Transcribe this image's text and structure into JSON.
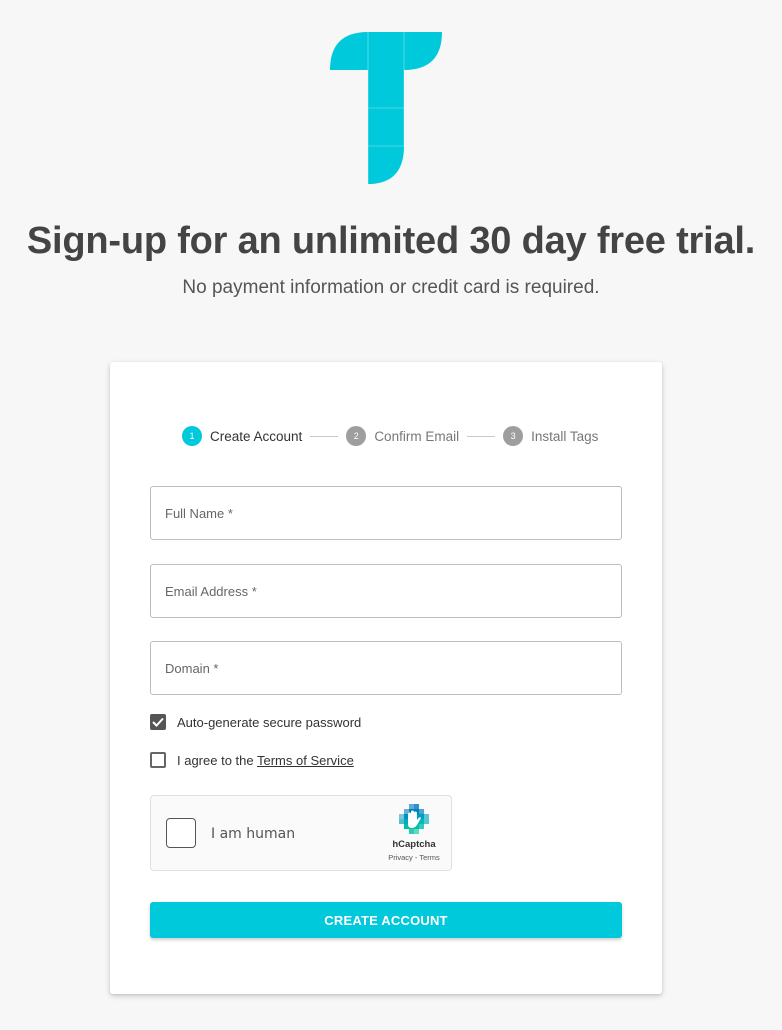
{
  "brand": {
    "accent": "#00c9db",
    "logo_icon": "t-logo-icon"
  },
  "headline": "Sign-up for an unlimited 30 day free trial.",
  "subline": "No payment information or credit card is required.",
  "stepper": {
    "steps": [
      {
        "num": "1",
        "label": "Create Account",
        "active": true
      },
      {
        "num": "2",
        "label": "Confirm Email",
        "active": false
      },
      {
        "num": "3",
        "label": "Install Tags",
        "active": false
      }
    ]
  },
  "form": {
    "full_name": {
      "placeholder": "Full Name *",
      "value": ""
    },
    "email": {
      "placeholder": "Email Address *",
      "value": ""
    },
    "domain": {
      "placeholder": "Domain *",
      "value": ""
    },
    "auto_password": {
      "label": "Auto-generate secure password",
      "checked": true
    },
    "terms": {
      "label_prefix": "I agree to the ",
      "link_text": "Terms of Service",
      "checked": false
    }
  },
  "captcha": {
    "label": "I am human",
    "brand": "hCaptcha",
    "links": "Privacy - Terms"
  },
  "submit_label": "CREATE ACCOUNT"
}
